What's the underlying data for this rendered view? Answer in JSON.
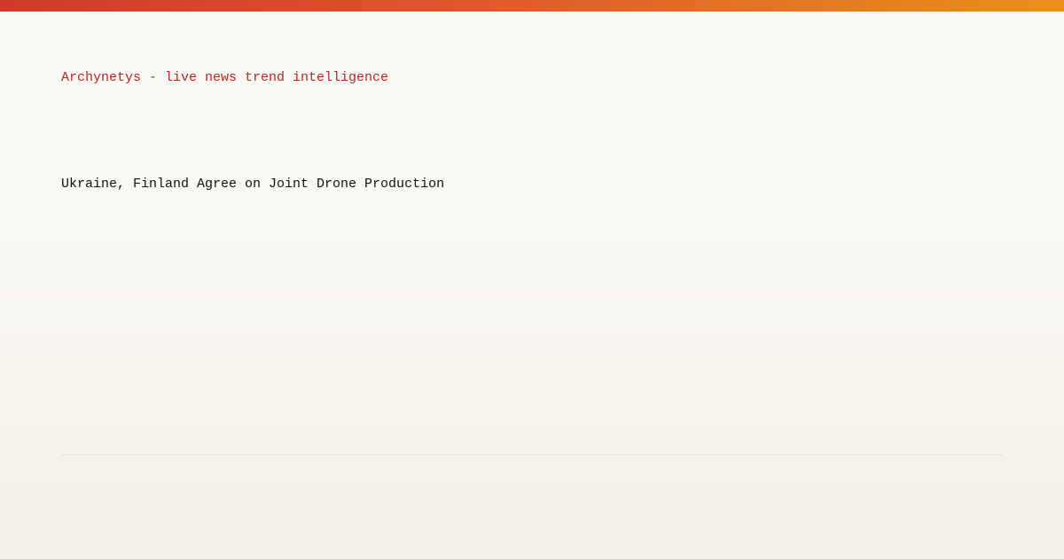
{
  "brand": {
    "tagline": "Archynetys - live news trend intelligence"
  },
  "article": {
    "headline": "Ukraine, Finland Agree on Joint Drone Production"
  },
  "colors": {
    "accent_start": "#cd3a2b",
    "accent_end": "#e8911a",
    "tagline_text": "#b5281f",
    "headline_text": "#111111",
    "background": "#f9f7f2"
  }
}
